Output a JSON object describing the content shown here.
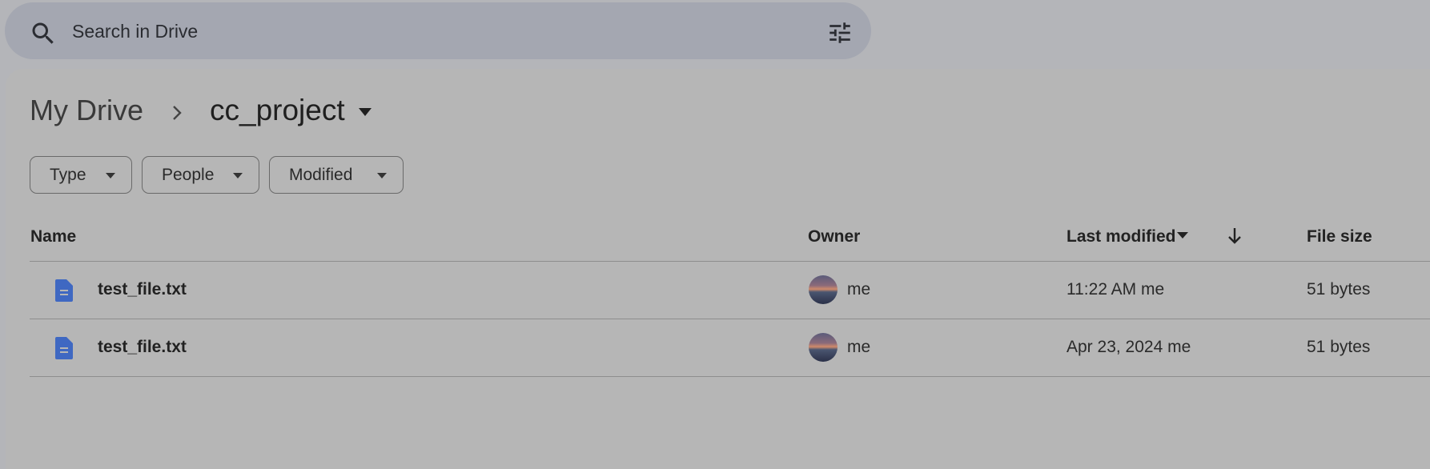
{
  "search": {
    "placeholder": "Search in Drive",
    "icon": "search-icon",
    "filter_icon": "filter-options-icon"
  },
  "breadcrumb": {
    "root": "My Drive",
    "current": "cc_project"
  },
  "filters": [
    {
      "label": "Type"
    },
    {
      "label": "People"
    },
    {
      "label": "Modified"
    }
  ],
  "table": {
    "columns": {
      "name": "Name",
      "owner": "Owner",
      "last_modified": "Last modified",
      "file_size": "File size"
    },
    "rows": [
      {
        "name": "test_file.txt",
        "owner": "me",
        "modified": "11:22 AM",
        "modified_by": "me",
        "size": "51 bytes"
      },
      {
        "name": "test_file.txt",
        "owner": "me",
        "modified": "Apr 23, 2024",
        "modified_by": "me",
        "size": "51 bytes"
      }
    ]
  },
  "colors": {
    "page_background": "#b4b5b9",
    "search_background": "#a4a7b1",
    "file_icon": "#3f68c2"
  }
}
